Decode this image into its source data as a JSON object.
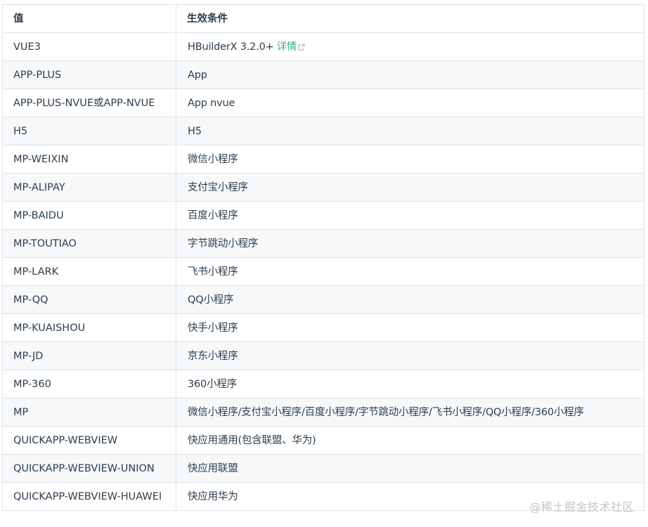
{
  "table": {
    "headers": [
      "值",
      "生效条件"
    ],
    "rows": [
      {
        "value": "VUE3",
        "condition": "HBuilderX 3.2.0+",
        "link_label": "详情"
      },
      {
        "value": "APP-PLUS",
        "condition": "App"
      },
      {
        "value": "APP-PLUS-NVUE或APP-NVUE",
        "condition": "App nvue"
      },
      {
        "value": "H5",
        "condition": "H5"
      },
      {
        "value": "MP-WEIXIN",
        "condition": "微信小程序"
      },
      {
        "value": "MP-ALIPAY",
        "condition": "支付宝小程序"
      },
      {
        "value": "MP-BAIDU",
        "condition": "百度小程序"
      },
      {
        "value": "MP-TOUTIAO",
        "condition": "字节跳动小程序"
      },
      {
        "value": "MP-LARK",
        "condition": "飞书小程序"
      },
      {
        "value": "MP-QQ",
        "condition": "QQ小程序"
      },
      {
        "value": "MP-KUAISHOU",
        "condition": "快手小程序"
      },
      {
        "value": "MP-JD",
        "condition": "京东小程序"
      },
      {
        "value": "MP-360",
        "condition": "360小程序"
      },
      {
        "value": "MP",
        "condition": "微信小程序/支付宝小程序/百度小程序/字节跳动小程序/飞书小程序/QQ小程序/360小程序"
      },
      {
        "value": "QUICKAPP-WEBVIEW",
        "condition": "快应用通用(包含联盟、华为)"
      },
      {
        "value": "QUICKAPP-WEBVIEW-UNION",
        "condition": "快应用联盟"
      },
      {
        "value": "QUICKAPP-WEBVIEW-HUAWEI",
        "condition": "快应用华为"
      }
    ]
  },
  "colors": {
    "link": "#3eaf7c",
    "border": "#dfe2e5",
    "stripe": "#f6f8fa",
    "text": "#2c3e50"
  },
  "icons": {
    "detail_link": "external-link-icon"
  },
  "watermark": "@稀土掘金技术社区"
}
